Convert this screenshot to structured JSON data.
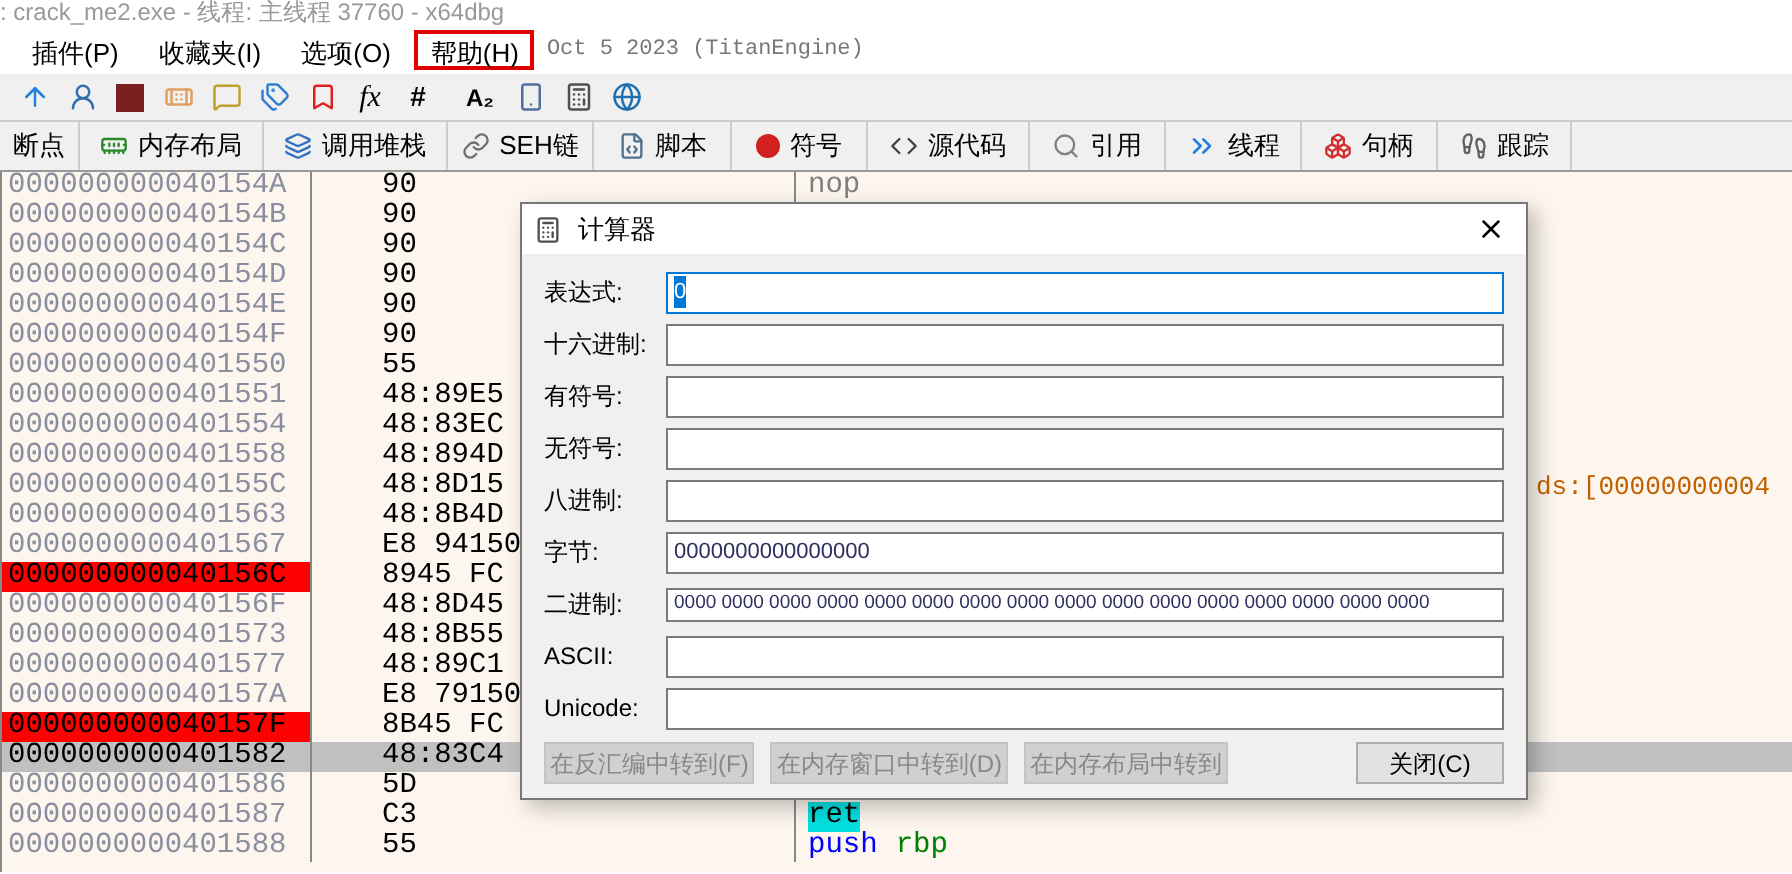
{
  "window": {
    "title": ": crack_me2.exe - 线程: 主线程 37760 - x64dbg"
  },
  "menu": {
    "items": [
      {
        "label": "插件(P)",
        "highlighted": false
      },
      {
        "label": "收藏夹(I)",
        "highlighted": false
      },
      {
        "label": "选项(O)",
        "highlighted": false
      },
      {
        "label": "帮助(H)",
        "highlighted": true
      }
    ],
    "build_info": "Oct 5 2023 (TitanEngine)"
  },
  "toolbar": {
    "text_buttons": [
      "fx",
      "#",
      "A₂"
    ]
  },
  "tabs": [
    {
      "label": "断点"
    },
    {
      "label": "内存布局"
    },
    {
      "label": "调用堆栈"
    },
    {
      "label": "SEH链"
    },
    {
      "label": "脚本"
    },
    {
      "label": "符号"
    },
    {
      "label": "源代码"
    },
    {
      "label": "引用"
    },
    {
      "label": "线程"
    },
    {
      "label": "句柄"
    },
    {
      "label": "跟踪"
    }
  ],
  "disassembly": {
    "rows": [
      {
        "address": "000000000040154A",
        "bytes": "90",
        "breakpoint": false,
        "selected": false,
        "instruction": [
          {
            "kind": "nop",
            "text": "nop"
          }
        ]
      },
      {
        "address": "000000000040154B",
        "bytes": "90",
        "breakpoint": false,
        "selected": false,
        "instruction": []
      },
      {
        "address": "000000000040154C",
        "bytes": "90",
        "breakpoint": false,
        "selected": false,
        "instruction": []
      },
      {
        "address": "000000000040154D",
        "bytes": "90",
        "breakpoint": false,
        "selected": false,
        "instruction": []
      },
      {
        "address": "000000000040154E",
        "bytes": "90",
        "breakpoint": false,
        "selected": false,
        "instruction": []
      },
      {
        "address": "000000000040154F",
        "bytes": "90",
        "breakpoint": false,
        "selected": false,
        "instruction": []
      },
      {
        "address": "0000000000401550",
        "bytes": "55",
        "breakpoint": false,
        "selected": false,
        "instruction": []
      },
      {
        "address": "0000000000401551",
        "bytes": "48:89E5",
        "breakpoint": false,
        "selected": false,
        "instruction": []
      },
      {
        "address": "0000000000401554",
        "bytes": "48:83EC",
        "breakpoint": false,
        "selected": false,
        "instruction": []
      },
      {
        "address": "0000000000401558",
        "bytes": "48:894D",
        "breakpoint": false,
        "selected": false,
        "instruction": []
      },
      {
        "address": "000000000040155C",
        "bytes": "48:8D15",
        "breakpoint": false,
        "selected": false,
        "instruction": [
          {
            "kind": "memory_tail",
            "text": "ds:[00000000004"
          }
        ]
      },
      {
        "address": "0000000000401563",
        "bytes": "48:8B4D",
        "breakpoint": false,
        "selected": false,
        "instruction": []
      },
      {
        "address": "0000000000401567",
        "bytes": "E8 94150",
        "breakpoint": false,
        "selected": false,
        "instruction": []
      },
      {
        "address": "000000000040156C",
        "bytes": "8945 FC",
        "breakpoint": true,
        "selected": false,
        "instruction": []
      },
      {
        "address": "000000000040156F",
        "bytes": "48:8D45",
        "breakpoint": false,
        "selected": false,
        "instruction": []
      },
      {
        "address": "0000000000401573",
        "bytes": "48:8B55",
        "breakpoint": false,
        "selected": false,
        "instruction": []
      },
      {
        "address": "0000000000401577",
        "bytes": "48:89C1",
        "breakpoint": false,
        "selected": false,
        "instruction": []
      },
      {
        "address": "000000000040157A",
        "bytes": "E8 79150",
        "breakpoint": false,
        "selected": false,
        "instruction": []
      },
      {
        "address": "000000000040157F",
        "bytes": "8B45 FC",
        "breakpoint": true,
        "selected": false,
        "instruction": []
      },
      {
        "address": "0000000000401582",
        "bytes": "48:83C4",
        "breakpoint": false,
        "selected": true,
        "instruction": []
      },
      {
        "address": "0000000000401586",
        "bytes": "5D",
        "breakpoint": false,
        "selected": false,
        "instruction": []
      },
      {
        "address": "0000000000401587",
        "bytes": "C3",
        "breakpoint": false,
        "selected": false,
        "instruction": [
          {
            "kind": "return",
            "text": "ret"
          }
        ]
      },
      {
        "address": "0000000000401588",
        "bytes": "55",
        "breakpoint": false,
        "selected": false,
        "instruction": [
          {
            "kind": "mnemonic",
            "text": "push"
          },
          {
            "kind": "register",
            "text": "rbp"
          }
        ]
      }
    ]
  },
  "calculator": {
    "title": "计算器",
    "fields": [
      {
        "label": "表达式:",
        "value": "0",
        "focused": true,
        "kind": "normal"
      },
      {
        "label": "十六进制:",
        "focused": false,
        "kind": "normal"
      },
      {
        "label": "有符号:",
        "focused": false,
        "kind": "normal"
      },
      {
        "label": "无符号:",
        "focused": false,
        "kind": "normal"
      },
      {
        "label": "八进制:",
        "focused": false,
        "kind": "normal"
      },
      {
        "label": "字节:",
        "value": "0000000000000000",
        "focused": false,
        "kind": "normal"
      },
      {
        "label": "二进制:",
        "value": "0000 0000 0000 0000 0000 0000 0000 0000 0000 0000 0000 0000 0000 0000 0000 0000",
        "focused": false,
        "kind": "small"
      },
      {
        "label": "ASCII:",
        "focused": false,
        "kind": "normal"
      },
      {
        "label": "Unicode:",
        "focused": false,
        "kind": "normal"
      }
    ],
    "buttons": [
      {
        "label": "在反汇编中转到(F)",
        "disabled": true
      },
      {
        "label": "在内存窗口中转到(D)",
        "disabled": true
      },
      {
        "label": "在内存布局中转到",
        "disabled": true
      },
      {
        "label": "关闭(C)",
        "disabled": false
      }
    ]
  }
}
